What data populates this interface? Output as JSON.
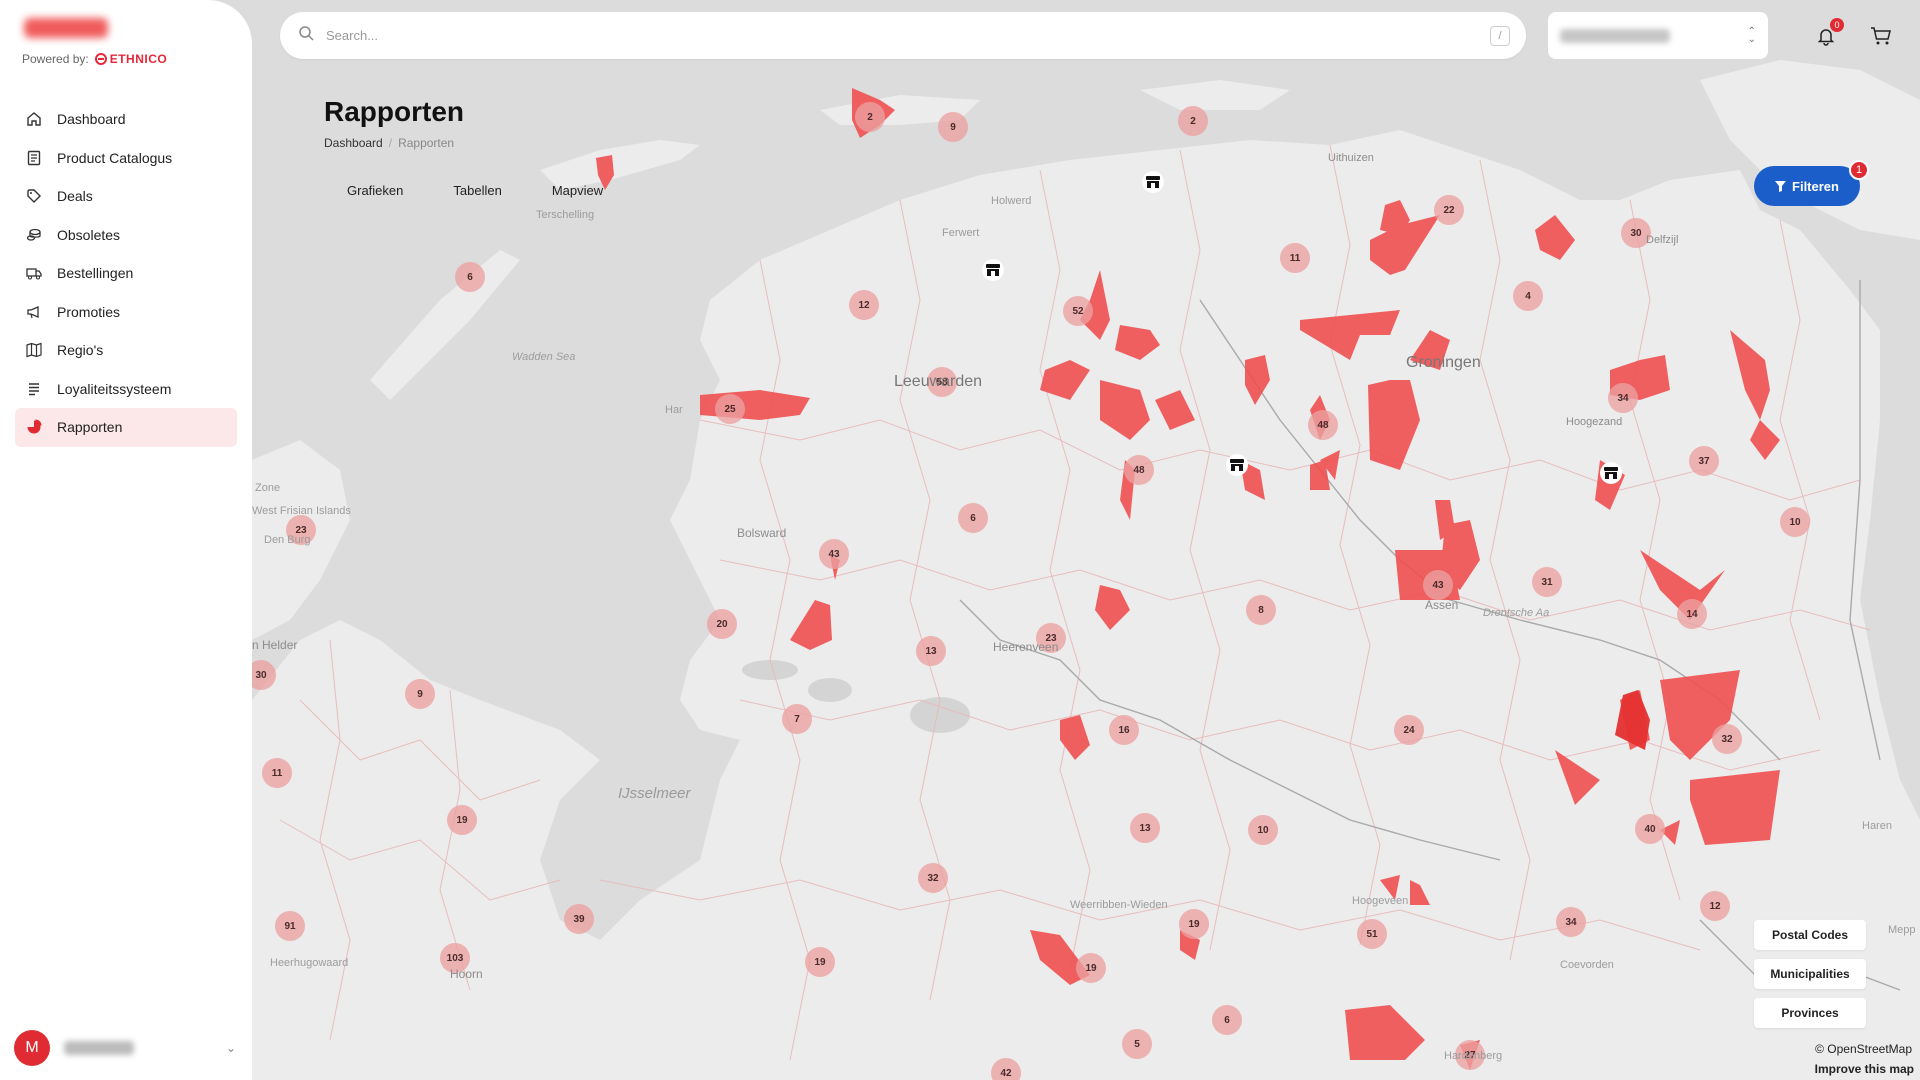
{
  "app": {
    "powered_by": "Powered by:",
    "brand": "ETHNICO"
  },
  "sidebar": {
    "items": [
      {
        "label": "Dashboard",
        "icon": "home-icon"
      },
      {
        "label": "Product Catalogus",
        "icon": "catalog-icon"
      },
      {
        "label": "Deals",
        "icon": "tag-icon"
      },
      {
        "label": "Obsoletes",
        "icon": "coins-icon"
      },
      {
        "label": "Bestellingen",
        "icon": "truck-icon"
      },
      {
        "label": "Promoties",
        "icon": "megaphone-icon"
      },
      {
        "label": "Regio's",
        "icon": "map-icon"
      },
      {
        "label": "Loyaliteitssysteem",
        "icon": "list-icon"
      },
      {
        "label": "Rapporten",
        "icon": "pie-chart-icon",
        "active": true
      }
    ],
    "user_initial": "M"
  },
  "search": {
    "placeholder": "Search...",
    "shortcut": "/"
  },
  "notifications": {
    "count": "0"
  },
  "page": {
    "title": "Rapporten",
    "breadcrumb": [
      "Dashboard",
      "Rapporten"
    ],
    "tabs": [
      "Grafieken",
      "Tabellen",
      "Mapview"
    ],
    "active_tab": "Mapview"
  },
  "filter": {
    "label": "Filteren",
    "count": "1"
  },
  "layers": [
    "Postal Codes",
    "Municipalities",
    "Provinces"
  ],
  "map": {
    "attribution": "© OpenStreetMap",
    "improve": "Improve this map",
    "labels": {
      "leeuwarden": "Leeuwarden",
      "groningen": "Groningen",
      "ijsselmeer": "IJsselmeer",
      "bolsward": "Bolsward",
      "heerenveen": "Heerenveen",
      "assen": "Assen",
      "hoogezand": "Hoogezand",
      "delfzijl": "Delfzijl",
      "uithuizen": "Uithuizen",
      "holwerd": "Holwerd",
      "ferwert": "Ferwert",
      "terschelling": "Terschelling",
      "waddenzee": "Wadden Sea",
      "west_frisian": "West Frisian Islands",
      "den_burg": "Den Burg",
      "den_helder": "n Helder",
      "harlingen": "Har",
      "hoorn": "Hoorn",
      "heerhugowaard": "Heerhugowaard",
      "weerribben": "Weerribben-Wieden",
      "hoogeveen": "Hoogeveen",
      "coevorden": "Coevorden",
      "hardenberg": "Hardenberg",
      "haren": "Haren",
      "drentsche_aa": "Drentsche Aa",
      "zone": "Zone",
      "meppel": "Mepp"
    },
    "clusters": [
      "2",
      "9",
      "2",
      "22",
      "30",
      "11",
      "4",
      "12",
      "52",
      "6",
      "58",
      "25",
      "48",
      "48",
      "6",
      "43",
      "20",
      "13",
      "23",
      "8",
      "31",
      "43",
      "14",
      "10",
      "37",
      "34",
      "23",
      "30",
      "9",
      "7",
      "11",
      "19",
      "16",
      "24",
      "32",
      "13",
      "10",
      "40",
      "32",
      "39",
      "91",
      "103",
      "19",
      "51",
      "19",
      "12",
      "34",
      "6",
      "5",
      "27",
      "42",
      "19"
    ]
  }
}
